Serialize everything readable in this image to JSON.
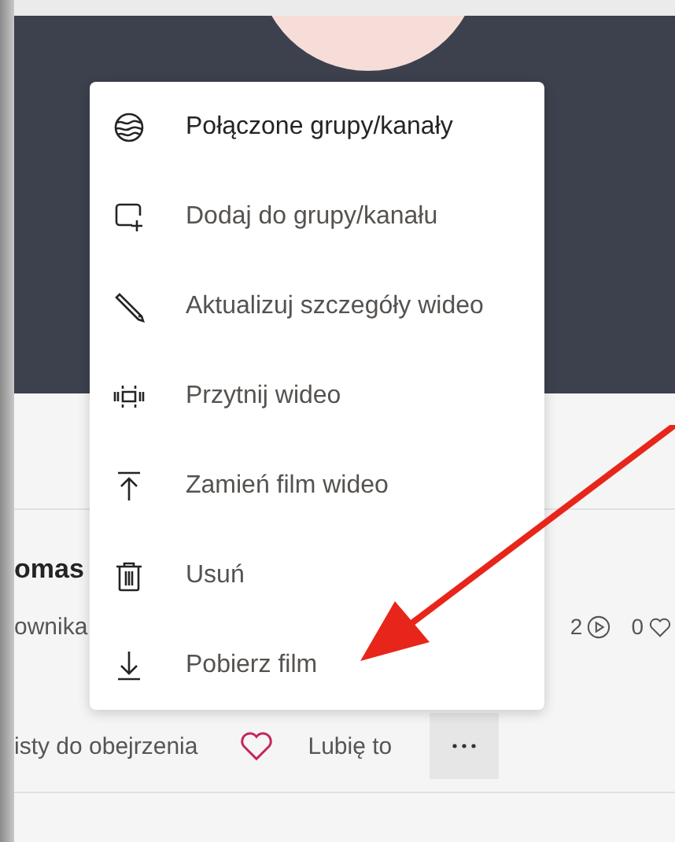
{
  "video": {
    "title": "omas",
    "subtitle": "ownika",
    "views": "2",
    "likes": "0",
    "watchlist_label": "isty do obejrzenia",
    "like_label": "Lubię to"
  },
  "menu": {
    "items": [
      {
        "label": "Połączone grupy/kanały",
        "kind": "linked",
        "emphasis": true
      },
      {
        "label": "Dodaj do grupy/kanału",
        "kind": "add",
        "emphasis": false
      },
      {
        "label": "Aktualizuj szczegóły wideo",
        "kind": "edit",
        "emphasis": false
      },
      {
        "label": "Przytnij wideo",
        "kind": "trim",
        "emphasis": false
      },
      {
        "label": "Zamień film wideo",
        "kind": "replace",
        "emphasis": false
      },
      {
        "label": "Usuń",
        "kind": "delete",
        "emphasis": false
      },
      {
        "label": "Pobierz film",
        "kind": "download",
        "emphasis": false
      }
    ]
  }
}
